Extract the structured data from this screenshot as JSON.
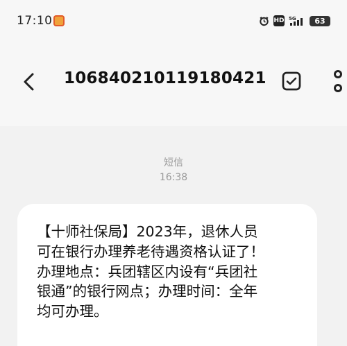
{
  "status_bar": {
    "time": "17:10",
    "network": "5G",
    "hd_label": "HD",
    "battery": "63"
  },
  "header": {
    "title": "106840210119180421",
    "icons": [
      "back-arrow-icon",
      "select-check-icon",
      "more-vertical-icon"
    ]
  },
  "conversation": {
    "message_type": "短信",
    "message_time": "16:38"
  },
  "message": {
    "text": "【十师社保局】2023年，退休人员\n可在银行办理养老待遇资格认证了！\n办理地点：兵团辖区内设有“兵团社\n银通”的银行网点；办理时间：全年\n均可办理。"
  },
  "colors": {
    "page_background": "#f2f2f2",
    "header_background": "#f7f7f7",
    "bubble_background": "#ffffff",
    "muted_text": "#9a9a9a",
    "primary_text": "#111111"
  }
}
